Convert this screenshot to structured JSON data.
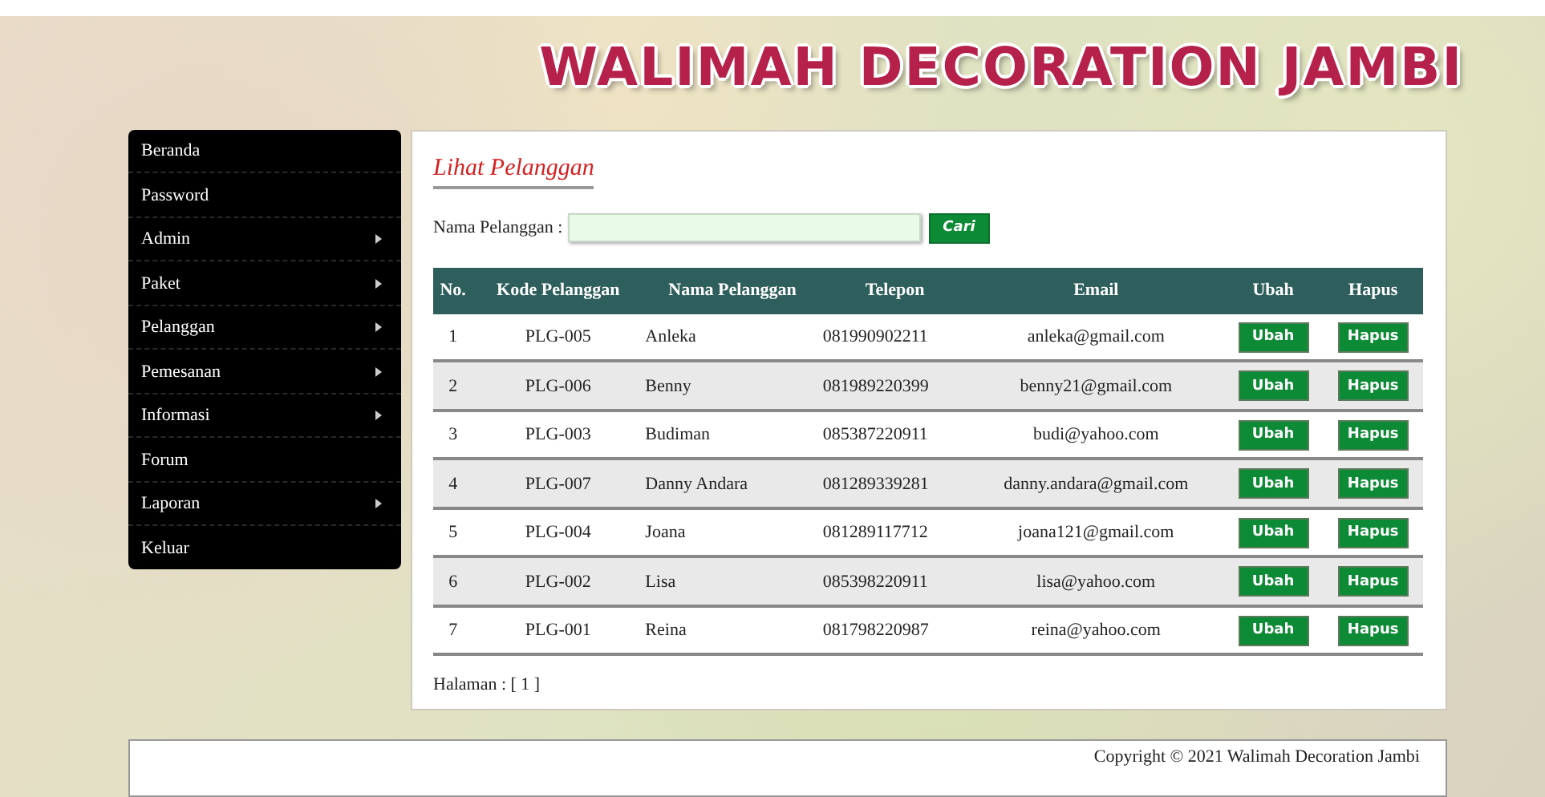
{
  "header": {
    "title": "WALIMAH DECORATION JAMBI"
  },
  "sidebar": {
    "items": [
      {
        "label": "Beranda",
        "submenu": false
      },
      {
        "label": "Password",
        "submenu": false
      },
      {
        "label": "Admin",
        "submenu": true
      },
      {
        "label": "Paket",
        "submenu": true
      },
      {
        "label": "Pelanggan",
        "submenu": true
      },
      {
        "label": "Pemesanan",
        "submenu": true
      },
      {
        "label": "Informasi",
        "submenu": true
      },
      {
        "label": "Forum",
        "submenu": false
      },
      {
        "label": "Laporan",
        "submenu": true
      },
      {
        "label": "Keluar",
        "submenu": false
      }
    ]
  },
  "page": {
    "title": "Lihat Pelanggan",
    "search": {
      "label": "Nama Pelanggan :",
      "button": "Cari"
    },
    "table": {
      "columns": [
        "No.",
        "Kode Pelanggan",
        "Nama Pelanggan",
        "Telepon",
        "Email",
        "Ubah",
        "Hapus"
      ],
      "rows": [
        {
          "no": "1",
          "kode": "PLG-005",
          "nama": "Anleka",
          "telepon": "081990902211",
          "email": "anleka@gmail.com",
          "ubah": "Ubah",
          "hapus": "Hapus"
        },
        {
          "no": "2",
          "kode": "PLG-006",
          "nama": "Benny",
          "telepon": "081989220399",
          "email": "benny21@gmail.com",
          "ubah": "Ubah",
          "hapus": "Hapus"
        },
        {
          "no": "3",
          "kode": "PLG-003",
          "nama": "Budiman",
          "telepon": "085387220911",
          "email": "budi@yahoo.com",
          "ubah": "Ubah",
          "hapus": "Hapus"
        },
        {
          "no": "4",
          "kode": "PLG-007",
          "nama": "Danny Andara",
          "telepon": "081289339281",
          "email": "danny.andara@gmail.com",
          "ubah": "Ubah",
          "hapus": "Hapus"
        },
        {
          "no": "5",
          "kode": "PLG-004",
          "nama": "Joana",
          "telepon": "081289117712",
          "email": "joana121@gmail.com",
          "ubah": "Ubah",
          "hapus": "Hapus"
        },
        {
          "no": "6",
          "kode": "PLG-002",
          "nama": "Lisa",
          "telepon": "085398220911",
          "email": "lisa@yahoo.com",
          "ubah": "Ubah",
          "hapus": "Hapus"
        },
        {
          "no": "7",
          "kode": "PLG-001",
          "nama": "Reina",
          "telepon": "081798220987",
          "email": "reina@yahoo.com",
          "ubah": "Ubah",
          "hapus": "Hapus"
        }
      ]
    },
    "pagination": "Halaman : [ 1 ]"
  },
  "footer": {
    "copyright": "Copyright © 2021 Walimah Decoration Jambi"
  }
}
